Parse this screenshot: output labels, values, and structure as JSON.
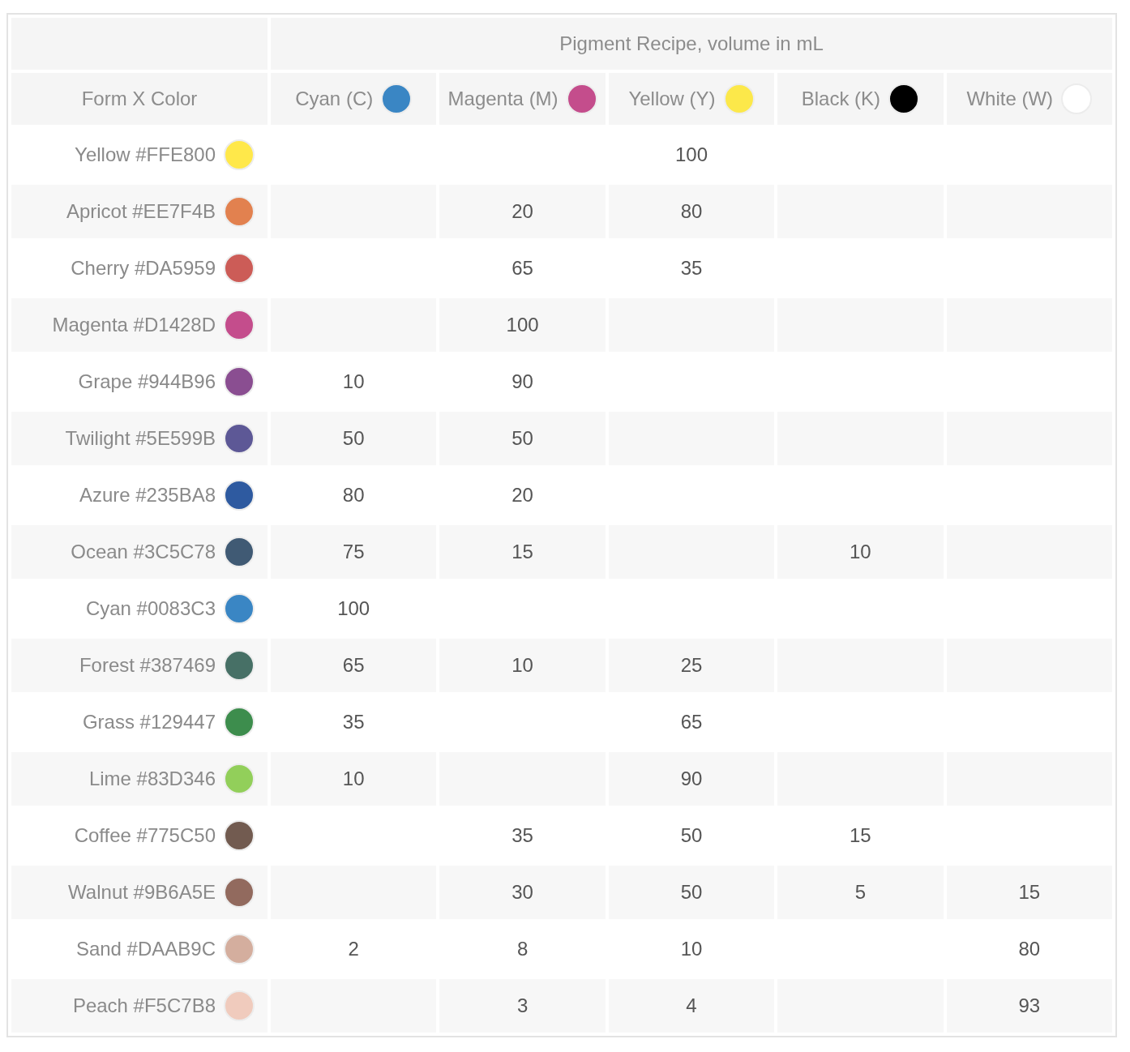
{
  "table": {
    "title": "Pigment Recipe, volume in mL",
    "first_column_heading": "Form X Color",
    "columns": [
      {
        "label": "Cyan (C)",
        "color": "#3a86c4"
      },
      {
        "label": "Magenta (M)",
        "color": "#c44d8c"
      },
      {
        "label": "Yellow (Y)",
        "color": "#fce84a"
      },
      {
        "label": "Black (K)",
        "color": "#000000"
      },
      {
        "label": "White (W)",
        "color": "#ffffff"
      }
    ],
    "rows": [
      {
        "name": "Yellow #FFE800",
        "color": "#ffe84a",
        "values": {
          "yellow": "100"
        }
      },
      {
        "name": "Apricot #EE7F4B",
        "color": "#e2814f",
        "values": {
          "magenta": "20",
          "yellow": "80"
        }
      },
      {
        "name": "Cherry #DA5959",
        "color": "#cc5c57",
        "values": {
          "magenta": "65",
          "yellow": "35"
        }
      },
      {
        "name": "Magenta #D1428D",
        "color": "#c44d8c",
        "values": {
          "magenta": "100"
        }
      },
      {
        "name": "Grape #944B96",
        "color": "#8a4e91",
        "values": {
          "cyan": "10",
          "magenta": "90"
        }
      },
      {
        "name": "Twilight #5E599B",
        "color": "#5d5896",
        "values": {
          "cyan": "50",
          "magenta": "50"
        }
      },
      {
        "name": "Azure #235BA8",
        "color": "#2e5aa0",
        "values": {
          "cyan": "80",
          "magenta": "20"
        }
      },
      {
        "name": "Ocean #3C5C78",
        "color": "#405a74",
        "values": {
          "cyan": "75",
          "magenta": "15",
          "black": "10"
        }
      },
      {
        "name": "Cyan #0083C3",
        "color": "#3a86c4",
        "values": {
          "cyan": "100"
        }
      },
      {
        "name": "Forest #387469",
        "color": "#477066",
        "values": {
          "cyan": "65",
          "magenta": "10",
          "yellow": "25"
        }
      },
      {
        "name": "Grass #129447",
        "color": "#3d8d4d",
        "values": {
          "cyan": "35",
          "yellow": "65"
        }
      },
      {
        "name": "Lime #83D346",
        "color": "#92cf5a",
        "values": {
          "cyan": "10",
          "yellow": "90"
        }
      },
      {
        "name": "Coffee #775C50",
        "color": "#725b50",
        "values": {
          "magenta": "35",
          "yellow": "50",
          "black": "15"
        }
      },
      {
        "name": "Walnut #9B6A5E",
        "color": "#926a5e",
        "values": {
          "magenta": "30",
          "yellow": "50",
          "black": "5",
          "white": "15"
        }
      },
      {
        "name": "Sand #DAAB9C",
        "color": "#d4ae9e",
        "values": {
          "cyan": "2",
          "magenta": "8",
          "yellow": "10",
          "white": "80"
        }
      },
      {
        "name": "Peach #F5C7B8",
        "color": "#f0cbbd",
        "values": {
          "magenta": "3",
          "yellow": "4",
          "white": "93"
        }
      }
    ]
  }
}
